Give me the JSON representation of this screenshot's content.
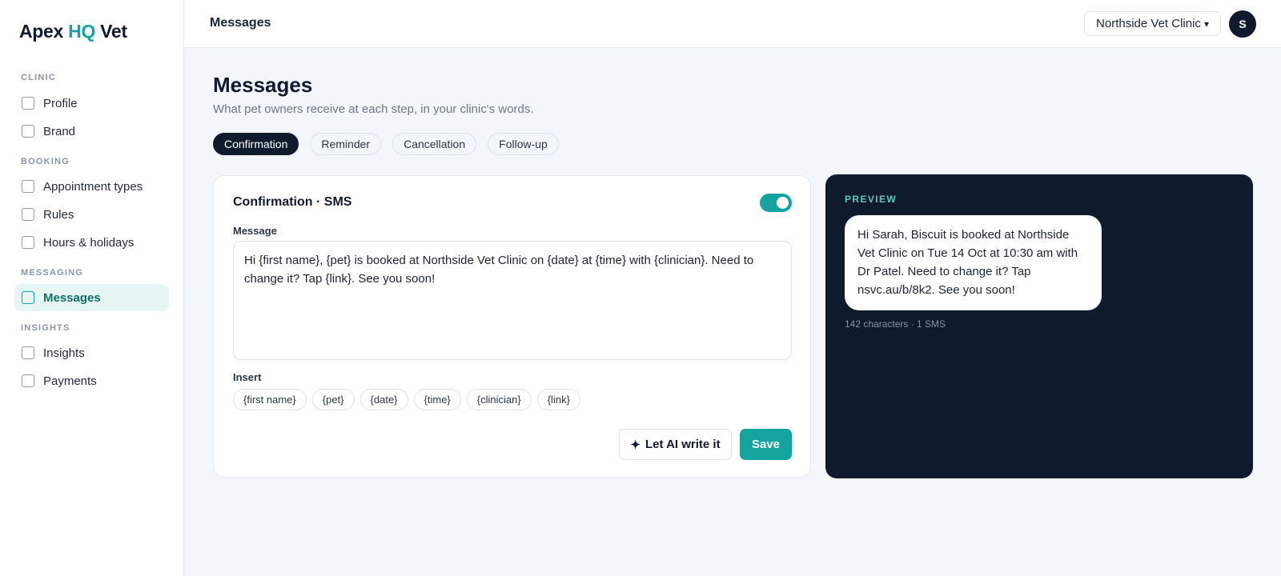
{
  "app": {
    "logo_part1": "Apex",
    "logo_part2": "HQ",
    "logo_part3": "Vet"
  },
  "sidebar": {
    "sections": [
      {
        "label": "CLINIC",
        "items": [
          {
            "label": "Profile"
          },
          {
            "label": "Brand"
          }
        ]
      },
      {
        "label": "BOOKING",
        "items": [
          {
            "label": "Appointment types"
          },
          {
            "label": "Rules"
          },
          {
            "label": "Hours & holidays"
          }
        ]
      },
      {
        "label": "MESSAGING",
        "items": [
          {
            "label": "Messages",
            "active": true
          }
        ]
      },
      {
        "label": "INSIGHTS",
        "items": [
          {
            "label": "Insights"
          },
          {
            "label": "Payments"
          }
        ]
      }
    ]
  },
  "topbar": {
    "title": "Messages",
    "clinic_select": "Northside Vet Clinic",
    "avatar_initial": "S"
  },
  "page": {
    "title": "Messages",
    "subtitle": "What pet owners receive at each step, in your clinic's words."
  },
  "tabs": [
    {
      "label": "Confirmation",
      "active": true
    },
    {
      "label": "Reminder"
    },
    {
      "label": "Cancellation"
    },
    {
      "label": "Follow-up"
    }
  ],
  "editor": {
    "title": "Confirmation · SMS",
    "toggle_on": true,
    "message_label": "Message",
    "message_value": "Hi {first name}, {pet} is booked at Northside Vet Clinic on {date} at {time} with {clinician}. Need to change it? Tap {link}. See you soon!",
    "insert_label": "Insert",
    "insert_tokens": [
      "{first name}",
      "{pet}",
      "{date}",
      "{time}",
      "{clinician}",
      "{link}"
    ],
    "ai_button": "Let AI write it",
    "save_button": "Save"
  },
  "preview": {
    "label": "PREVIEW",
    "message": "Hi Sarah, Biscuit is booked at Northside Vet Clinic on Tue 14 Oct at 10:30 am with Dr Patel. Need to change it? Tap nsvc.au/b/8k2. See you soon!",
    "meta": "142 characters · 1 SMS"
  },
  "colors": {
    "accent": "#14a39e",
    "navy": "#0f1b2d",
    "background": "#f3f6fa"
  }
}
